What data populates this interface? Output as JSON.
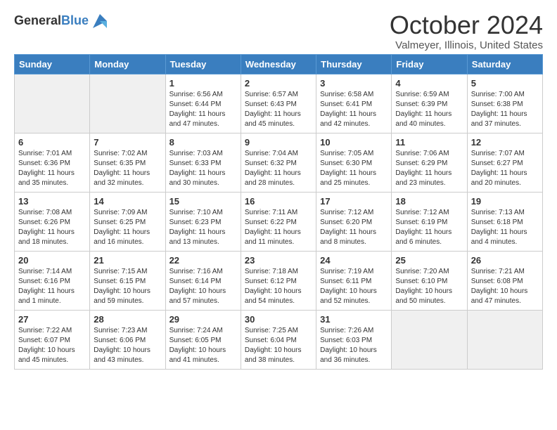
{
  "header": {
    "logo_general": "General",
    "logo_blue": "Blue",
    "month_title": "October 2024",
    "location": "Valmeyer, Illinois, United States"
  },
  "days_of_week": [
    "Sunday",
    "Monday",
    "Tuesday",
    "Wednesday",
    "Thursday",
    "Friday",
    "Saturday"
  ],
  "weeks": [
    [
      {
        "day": "",
        "info": ""
      },
      {
        "day": "",
        "info": ""
      },
      {
        "day": "1",
        "info": "Sunrise: 6:56 AM\nSunset: 6:44 PM\nDaylight: 11 hours and 47 minutes."
      },
      {
        "day": "2",
        "info": "Sunrise: 6:57 AM\nSunset: 6:43 PM\nDaylight: 11 hours and 45 minutes."
      },
      {
        "day": "3",
        "info": "Sunrise: 6:58 AM\nSunset: 6:41 PM\nDaylight: 11 hours and 42 minutes."
      },
      {
        "day": "4",
        "info": "Sunrise: 6:59 AM\nSunset: 6:39 PM\nDaylight: 11 hours and 40 minutes."
      },
      {
        "day": "5",
        "info": "Sunrise: 7:00 AM\nSunset: 6:38 PM\nDaylight: 11 hours and 37 minutes."
      }
    ],
    [
      {
        "day": "6",
        "info": "Sunrise: 7:01 AM\nSunset: 6:36 PM\nDaylight: 11 hours and 35 minutes."
      },
      {
        "day": "7",
        "info": "Sunrise: 7:02 AM\nSunset: 6:35 PM\nDaylight: 11 hours and 32 minutes."
      },
      {
        "day": "8",
        "info": "Sunrise: 7:03 AM\nSunset: 6:33 PM\nDaylight: 11 hours and 30 minutes."
      },
      {
        "day": "9",
        "info": "Sunrise: 7:04 AM\nSunset: 6:32 PM\nDaylight: 11 hours and 28 minutes."
      },
      {
        "day": "10",
        "info": "Sunrise: 7:05 AM\nSunset: 6:30 PM\nDaylight: 11 hours and 25 minutes."
      },
      {
        "day": "11",
        "info": "Sunrise: 7:06 AM\nSunset: 6:29 PM\nDaylight: 11 hours and 23 minutes."
      },
      {
        "day": "12",
        "info": "Sunrise: 7:07 AM\nSunset: 6:27 PM\nDaylight: 11 hours and 20 minutes."
      }
    ],
    [
      {
        "day": "13",
        "info": "Sunrise: 7:08 AM\nSunset: 6:26 PM\nDaylight: 11 hours and 18 minutes."
      },
      {
        "day": "14",
        "info": "Sunrise: 7:09 AM\nSunset: 6:25 PM\nDaylight: 11 hours and 16 minutes."
      },
      {
        "day": "15",
        "info": "Sunrise: 7:10 AM\nSunset: 6:23 PM\nDaylight: 11 hours and 13 minutes."
      },
      {
        "day": "16",
        "info": "Sunrise: 7:11 AM\nSunset: 6:22 PM\nDaylight: 11 hours and 11 minutes."
      },
      {
        "day": "17",
        "info": "Sunrise: 7:12 AM\nSunset: 6:20 PM\nDaylight: 11 hours and 8 minutes."
      },
      {
        "day": "18",
        "info": "Sunrise: 7:12 AM\nSunset: 6:19 PM\nDaylight: 11 hours and 6 minutes."
      },
      {
        "day": "19",
        "info": "Sunrise: 7:13 AM\nSunset: 6:18 PM\nDaylight: 11 hours and 4 minutes."
      }
    ],
    [
      {
        "day": "20",
        "info": "Sunrise: 7:14 AM\nSunset: 6:16 PM\nDaylight: 11 hours and 1 minute."
      },
      {
        "day": "21",
        "info": "Sunrise: 7:15 AM\nSunset: 6:15 PM\nDaylight: 10 hours and 59 minutes."
      },
      {
        "day": "22",
        "info": "Sunrise: 7:16 AM\nSunset: 6:14 PM\nDaylight: 10 hours and 57 minutes."
      },
      {
        "day": "23",
        "info": "Sunrise: 7:18 AM\nSunset: 6:12 PM\nDaylight: 10 hours and 54 minutes."
      },
      {
        "day": "24",
        "info": "Sunrise: 7:19 AM\nSunset: 6:11 PM\nDaylight: 10 hours and 52 minutes."
      },
      {
        "day": "25",
        "info": "Sunrise: 7:20 AM\nSunset: 6:10 PM\nDaylight: 10 hours and 50 minutes."
      },
      {
        "day": "26",
        "info": "Sunrise: 7:21 AM\nSunset: 6:08 PM\nDaylight: 10 hours and 47 minutes."
      }
    ],
    [
      {
        "day": "27",
        "info": "Sunrise: 7:22 AM\nSunset: 6:07 PM\nDaylight: 10 hours and 45 minutes."
      },
      {
        "day": "28",
        "info": "Sunrise: 7:23 AM\nSunset: 6:06 PM\nDaylight: 10 hours and 43 minutes."
      },
      {
        "day": "29",
        "info": "Sunrise: 7:24 AM\nSunset: 6:05 PM\nDaylight: 10 hours and 41 minutes."
      },
      {
        "day": "30",
        "info": "Sunrise: 7:25 AM\nSunset: 6:04 PM\nDaylight: 10 hours and 38 minutes."
      },
      {
        "day": "31",
        "info": "Sunrise: 7:26 AM\nSunset: 6:03 PM\nDaylight: 10 hours and 36 minutes."
      },
      {
        "day": "",
        "info": ""
      },
      {
        "day": "",
        "info": ""
      }
    ]
  ]
}
